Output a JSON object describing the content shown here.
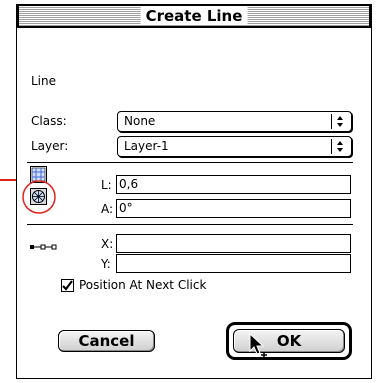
{
  "dialog": {
    "title": "Create Line",
    "section_title": "Line"
  },
  "class_field": {
    "label": "Class:",
    "value": "None"
  },
  "layer_field": {
    "label": "Layer:",
    "value": "Layer-1"
  },
  "length_field": {
    "label": "L:",
    "value": "0,6"
  },
  "angle_field": {
    "label": "A:",
    "value": "0°"
  },
  "x_field": {
    "label": "X:",
    "value": ""
  },
  "y_field": {
    "label": "Y:",
    "value": ""
  },
  "position_checkbox": {
    "label": "Position At Next Click",
    "checked": true
  },
  "buttons": {
    "cancel_label": "Cancel",
    "ok_label": "OK"
  },
  "colors": {
    "annotation_red": "#e0221e",
    "window_border": "#000000"
  },
  "icons": {
    "cartesian": "grid-icon",
    "polar": "polar-icon",
    "position": "line-endpoints-icon",
    "pointer": "cursor-arrow-icon"
  }
}
